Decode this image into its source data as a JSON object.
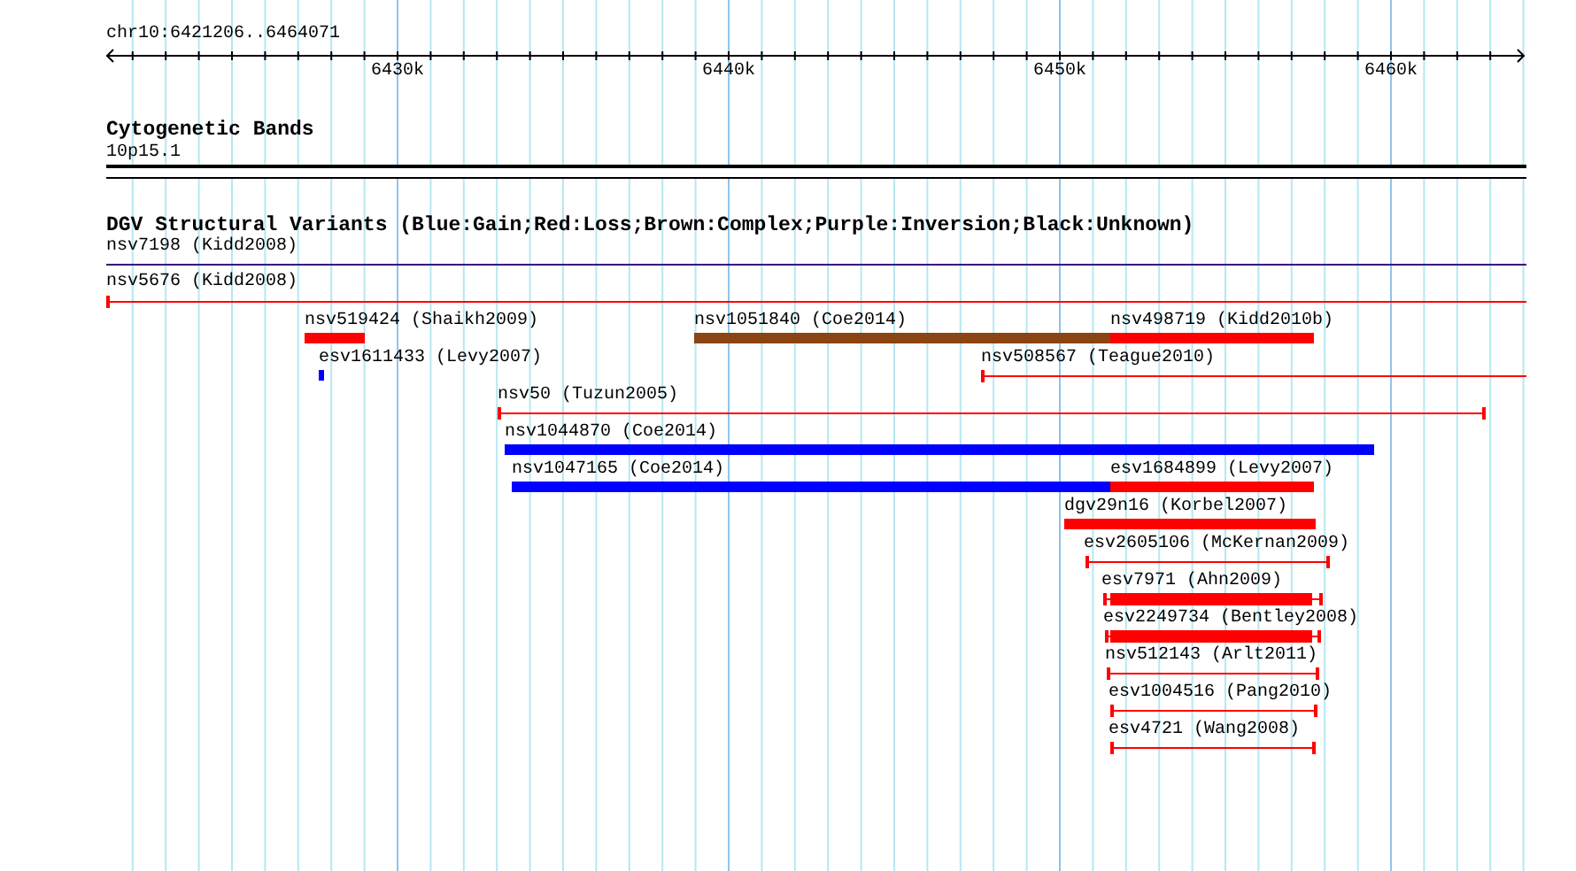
{
  "location": "chr10:6421206..6464071",
  "ruler": {
    "labels": [
      "6430k",
      "6440k",
      "6450k",
      "6460k"
    ]
  },
  "cytoband_track": {
    "title": "Cytogenetic Bands",
    "band": "10p15.1"
  },
  "dgv_track": {
    "title": "DGV Structural Variants (Blue:Gain;Red:Loss;Brown:Complex;Purple:Inversion;Black:Unknown)",
    "variants": [
      {
        "label": "nsv7198 (Kidd2008)",
        "kind": "line",
        "color": "#400080"
      },
      {
        "label": "nsv5676 (Kidd2008)",
        "kind": "line",
        "color": "#ff0000"
      },
      {
        "label": "nsv519424 (Shaikh2009)",
        "kind": "bar",
        "color": "#ff0000"
      },
      {
        "label": "nsv1051840 (Coe2014)",
        "kind": "bar",
        "color": "#8b4513"
      },
      {
        "label": "nsv498719 (Kidd2010b)",
        "kind": "bar",
        "color": "#ff0000"
      },
      {
        "label": "esv1611433 (Levy2007)",
        "kind": "bar",
        "color": "#0000ff"
      },
      {
        "label": "nsv508567 (Teague2010)",
        "kind": "line",
        "color": "#ff0000"
      },
      {
        "label": "nsv50 (Tuzun2005)",
        "kind": "line",
        "color": "#ff0000"
      },
      {
        "label": "nsv1044870 (Coe2014)",
        "kind": "bar",
        "color": "#0000ff"
      },
      {
        "label": "nsv1047165 (Coe2014)",
        "kind": "bar",
        "color": "#0000ff"
      },
      {
        "label": "esv1684899 (Levy2007)",
        "kind": "bar",
        "color": "#ff0000"
      },
      {
        "label": "dgv29n16 (Korbel2007)",
        "kind": "bar",
        "color": "#ff0000"
      },
      {
        "label": "esv2605106 (McKernan2009)",
        "kind": "line",
        "color": "#ff0000"
      },
      {
        "label": "esv7971 (Ahn2009)",
        "kind": "whisker",
        "color": "#ff0000"
      },
      {
        "label": "esv2249734 (Bentley2008)",
        "kind": "whisker",
        "color": "#ff0000"
      },
      {
        "label": "nsv512143 (Arlt2011)",
        "kind": "line",
        "color": "#ff0000"
      },
      {
        "label": "esv1004516 (Pang2010)",
        "kind": "line",
        "color": "#ff0000"
      },
      {
        "label": "esv4721 (Wang2008)",
        "kind": "line",
        "color": "#ff0000"
      }
    ]
  }
}
